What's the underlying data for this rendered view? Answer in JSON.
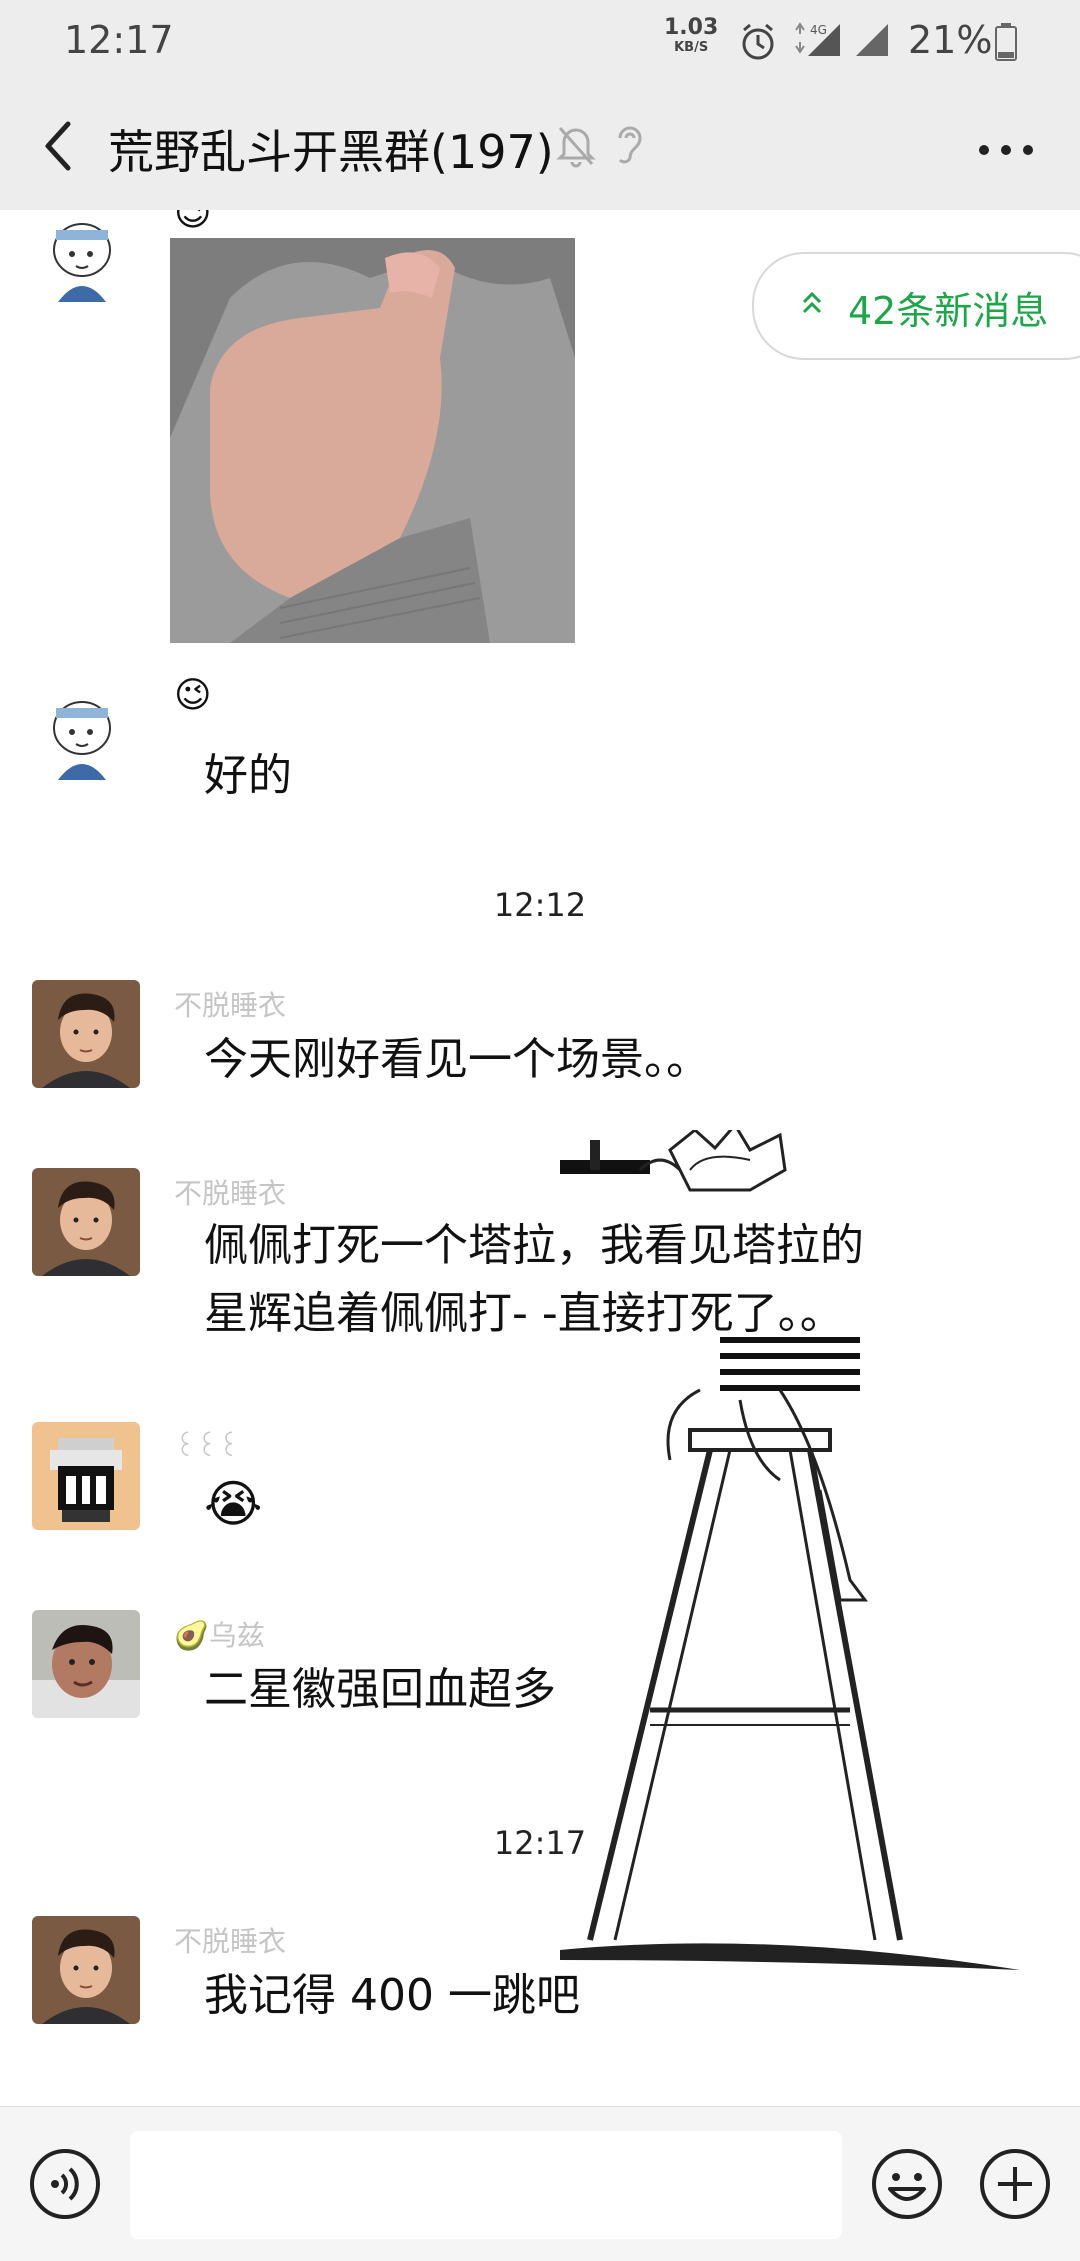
{
  "status_bar": {
    "time": "12:17",
    "net_speed_value": "1.03",
    "net_speed_unit": "KB/S",
    "network": "4G",
    "battery": "21%",
    "icons": [
      "alarm-icon",
      "signal-4g-icon",
      "signal-icon",
      "battery-icon"
    ]
  },
  "header": {
    "back_icon": "chevron-left-icon",
    "title": "荒野乱斗开黑群(197)",
    "icons": [
      "mute-bell-icon",
      "ear-icon"
    ],
    "more_icon": "more-dots-icon"
  },
  "new_messages": {
    "label": "42条新消息",
    "icon": "double-chevron-up-icon",
    "color": "#1fa54a"
  },
  "messages": [
    {
      "sender": "",
      "sender_emoji": "😉",
      "type": "image",
      "content": "thumbs-up-photo",
      "avatar": "cartoon-boy-avatar"
    },
    {
      "sender": "",
      "sender_emoji": "😉",
      "type": "text",
      "content": "好的",
      "avatar": "cartoon-boy-avatar"
    },
    {
      "type": "timestamp",
      "content": "12:12"
    },
    {
      "sender": "不脱睡衣",
      "type": "text",
      "content": "今天刚好看见一个场景。。",
      "avatar": "anime-man-avatar"
    },
    {
      "sender": "不脱睡衣",
      "type": "text",
      "lines": [
        "佩佩打死一个塔拉，我看见塔拉的",
        "星辉追着佩佩打- -直接打死了。。"
      ],
      "avatar": "anime-man-avatar"
    },
    {
      "sender": "꒰꒰꒰",
      "type": "text",
      "content": "😭",
      "avatar": "pixel-character-avatar"
    },
    {
      "sender": "乌兹",
      "sender_emoji": "🥑",
      "type": "text",
      "content": "二星徽强回血超多",
      "avatar": "photo-man-avatar"
    },
    {
      "type": "timestamp",
      "content": "12:17"
    },
    {
      "sender": "不脱睡衣",
      "type": "text",
      "content": "我记得 400 一跳吧",
      "avatar": "anime-man-avatar"
    }
  ],
  "input_bar": {
    "voice_icon": "voice-icon",
    "input_value": "",
    "emoji_icon": "emoji-icon",
    "plus_icon": "plus-icon"
  },
  "colors": {
    "header_bg": "#ededed",
    "chat_bg": "#ffffff",
    "accent": "#1fa54a",
    "nickname": "#c5c5c5"
  }
}
